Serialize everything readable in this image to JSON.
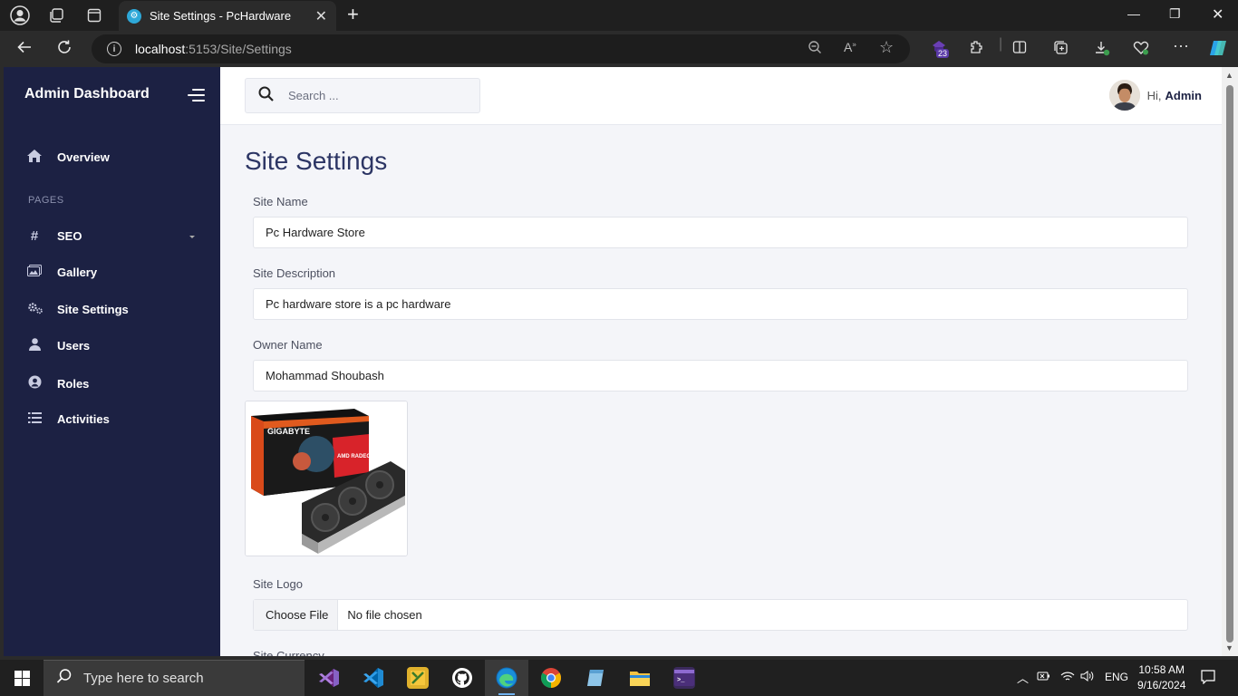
{
  "browser": {
    "tab_title": "Site Settings - PcHardware",
    "url_host": "localhost",
    "url_path": ":5153/Site/Settings",
    "extension_badge": "23"
  },
  "sidebar": {
    "brand": "Admin Dashboard",
    "overview": "Overview",
    "section_label": "PAGES",
    "items": [
      {
        "label": "SEO",
        "icon": "hash-icon"
      },
      {
        "label": "Gallery",
        "icon": "images-icon"
      },
      {
        "label": "Site Settings",
        "icon": "cogs-icon"
      },
      {
        "label": "Users",
        "icon": "user-icon"
      },
      {
        "label": "Roles",
        "icon": "user-circle-icon"
      },
      {
        "label": "Activities",
        "icon": "list-icon"
      }
    ]
  },
  "header": {
    "search_placeholder": "Search ...",
    "greeting": "Hi,",
    "username": "Admin"
  },
  "main": {
    "title": "Site Settings",
    "site_name_label": "Site Name",
    "site_name_value": "Pc Hardware Store",
    "site_description_label": "Site Description",
    "site_description_value": "Pc hardware store is a pc hardware",
    "owner_name_label": "Owner Name",
    "owner_name_value": "Mohammad Shoubash",
    "product_image_text": "GIGABYTE",
    "product_image_subtext": "AMD RADEON",
    "site_logo_label": "Site Logo",
    "file_button": "Choose File",
    "file_status": "No file chosen",
    "next_label": "Site Currency"
  },
  "taskbar": {
    "search_placeholder": "Type here to search",
    "language": "ENG",
    "time": "10:58 AM",
    "date": "9/16/2024"
  }
}
